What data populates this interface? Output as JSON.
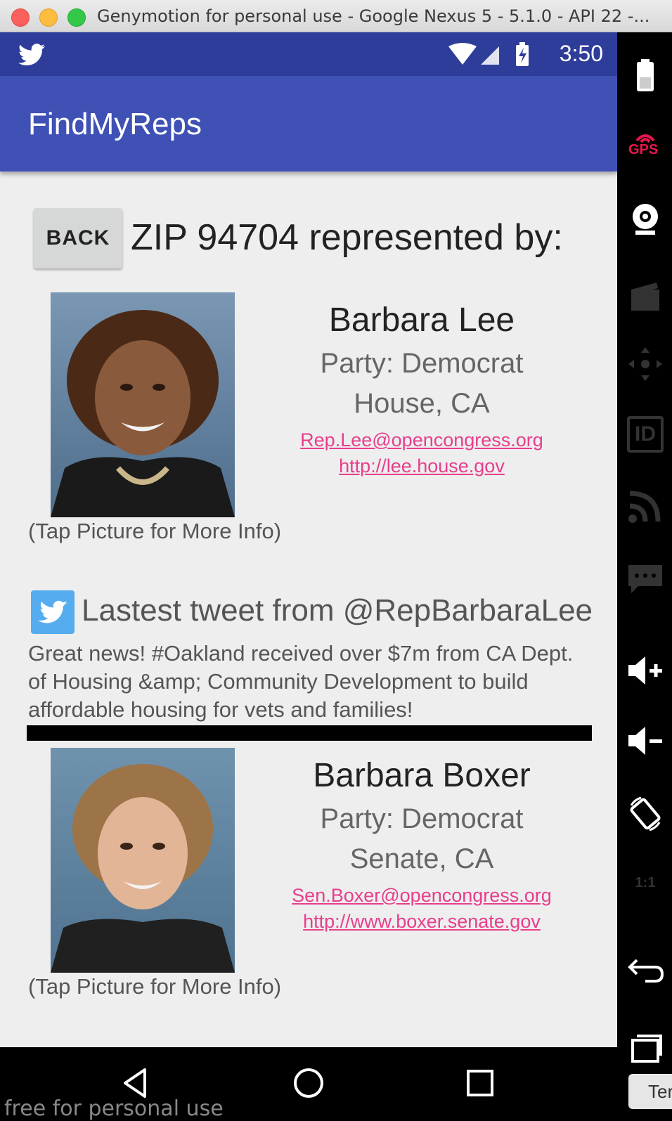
{
  "window": {
    "title": "Genymotion for personal use - Google Nexus 5 - 5.1.0 - API 22 -..."
  },
  "status_bar": {
    "time": "3:50"
  },
  "app_bar": {
    "title": "FindMyReps"
  },
  "header": {
    "back_label": "BACK",
    "zip_heading": "ZIP 94704 represented by:"
  },
  "reps": [
    {
      "name": "Barbara Lee",
      "party": "Party: Democrat",
      "chamber": "House, CA",
      "email": "Rep.Lee@opencongress.org",
      "website": "http://lee.house.gov",
      "tap_note": "(Tap Picture for More Info)"
    },
    {
      "name": "Barbara Boxer",
      "party": "Party: Democrat",
      "chamber": "Senate, CA",
      "email": "Sen.Boxer@opencongress.org",
      "website": "http://www.boxer.senate.gov",
      "tap_note": "(Tap Picture for More Info)"
    }
  ],
  "tweet": {
    "title": "Lastest tweet from @RepBarbaraLee",
    "text": "Great news! #Oakland received over $7m from CA Dept. of Housing &amp; Community Development to build affordable housing for vets and families!"
  },
  "side_panel": {
    "gps_label": "GPS",
    "id_label": "ID",
    "scale_label": "1:1",
    "bottom_label": "Ter"
  },
  "watermark": "free for personal use",
  "colors": {
    "primary": "#3f51b5",
    "primary_dark": "#2f3d9a",
    "link": "#e83e8c",
    "twitter": "#55acee"
  }
}
